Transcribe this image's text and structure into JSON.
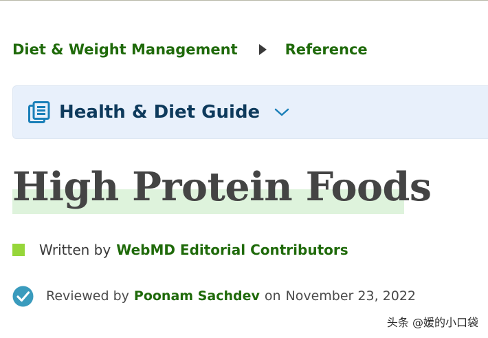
{
  "breadcrumb": {
    "parent": "Diet & Weight Management",
    "current": "Reference"
  },
  "guide": {
    "title": "Health & Diet Guide",
    "icon": "article-icon",
    "chevron": "chevron-down-icon"
  },
  "article": {
    "title": "High Protein Foods",
    "byline": {
      "prefix": "Written by",
      "author": "WebMD Editorial Contributors"
    },
    "review": {
      "prefix": "Reviewed by",
      "reviewer": "Poonam Sachdev",
      "date_prefix": "on",
      "date": "November 23, 2022"
    }
  },
  "watermark": "头条 @媛的小口袋",
  "colors": {
    "link_green": "#1f6a0a",
    "guide_bg": "#e8f0fb",
    "guide_text": "#0e3a5c",
    "icon_blue": "#1a7fb8",
    "highlight": "#def3dc",
    "byline_square": "#96d63a",
    "check_teal": "#3a9bbd"
  }
}
